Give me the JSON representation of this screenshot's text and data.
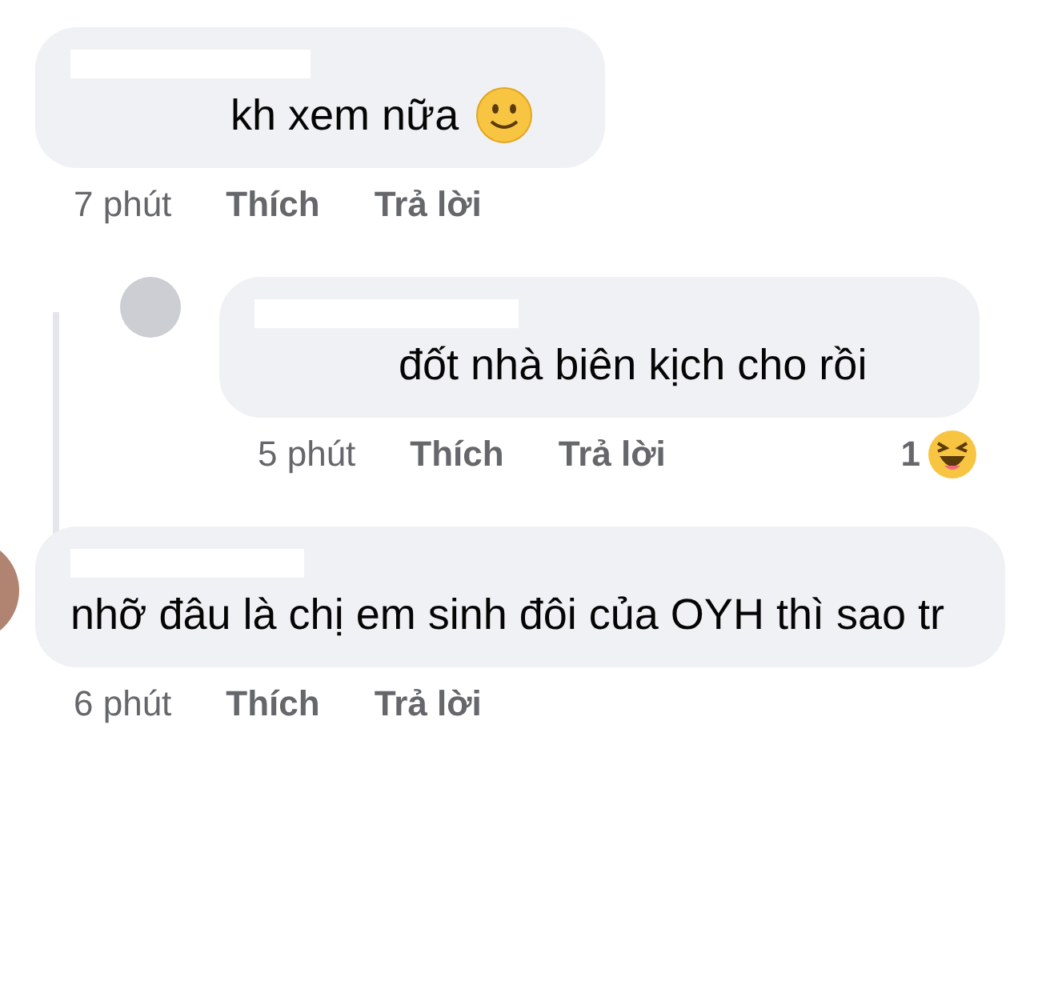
{
  "comments": [
    {
      "kind": "top",
      "text": "kh xem nữa",
      "trailing": {
        "kind": "smile"
      },
      "time": "7 phút",
      "like": "Thích",
      "reply": "Trả lời"
    },
    {
      "kind": "reply",
      "text": "đốt nhà biên kịch cho rồi",
      "time": "5 phút",
      "like": "Thích",
      "reply": "Trả lời",
      "reaction": {
        "count": "1",
        "kind": "haha"
      },
      "avatar": {
        "kind": "plain"
      }
    },
    {
      "kind": "top",
      "text": "nhỡ đâu là chị em sinh đôi của OYH thì sao tr",
      "time": "6 phút",
      "like": "Thích",
      "reply": "Trả lời",
      "avatar": {
        "kind": "photo"
      }
    }
  ]
}
